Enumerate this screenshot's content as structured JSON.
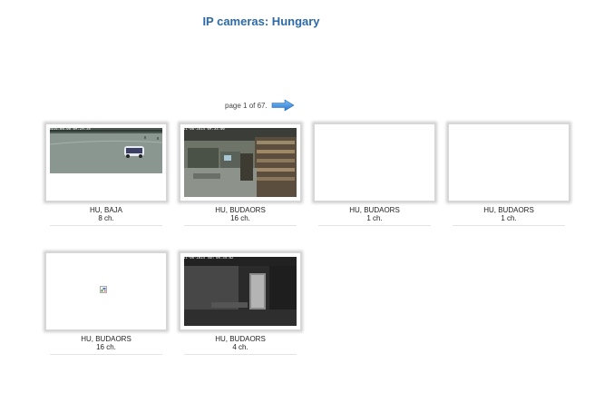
{
  "page_title": "IP cameras: Hungary",
  "pager": {
    "text": "page 1 of 67.",
    "next_icon": "right-arrow-icon",
    "accent": "#3d8fdd"
  },
  "colors": {
    "title": "#2d6aa6",
    "frame_shadow": "#cfcfcf"
  },
  "cameras": [
    {
      "location": "HU, BAJA",
      "channels": "8 ch.",
      "timestamp": "2014.08.08 09:29:58",
      "image": "parking-lot-feed"
    },
    {
      "location": "HU, BUDAORS",
      "channels": "16 ch.",
      "timestamp": "11-08-2014 09:33:00",
      "image": "store-interior-feed"
    },
    {
      "location": "HU, BUDAORS",
      "channels": "1 ch.",
      "timestamp": "",
      "image": "blank"
    },
    {
      "location": "HU, BUDAORS",
      "channels": "1 ch.",
      "timestamp": "",
      "image": "blank"
    },
    {
      "location": "HU, BUDAORS",
      "channels": "16 ch.",
      "timestamp": "",
      "image": "broken-image-icon"
    },
    {
      "location": "HU, BUDAORS",
      "channels": "4 ch.",
      "timestamp": "11-08-2014 Sun 08:34:02",
      "image": "dark-room-feed"
    }
  ]
}
